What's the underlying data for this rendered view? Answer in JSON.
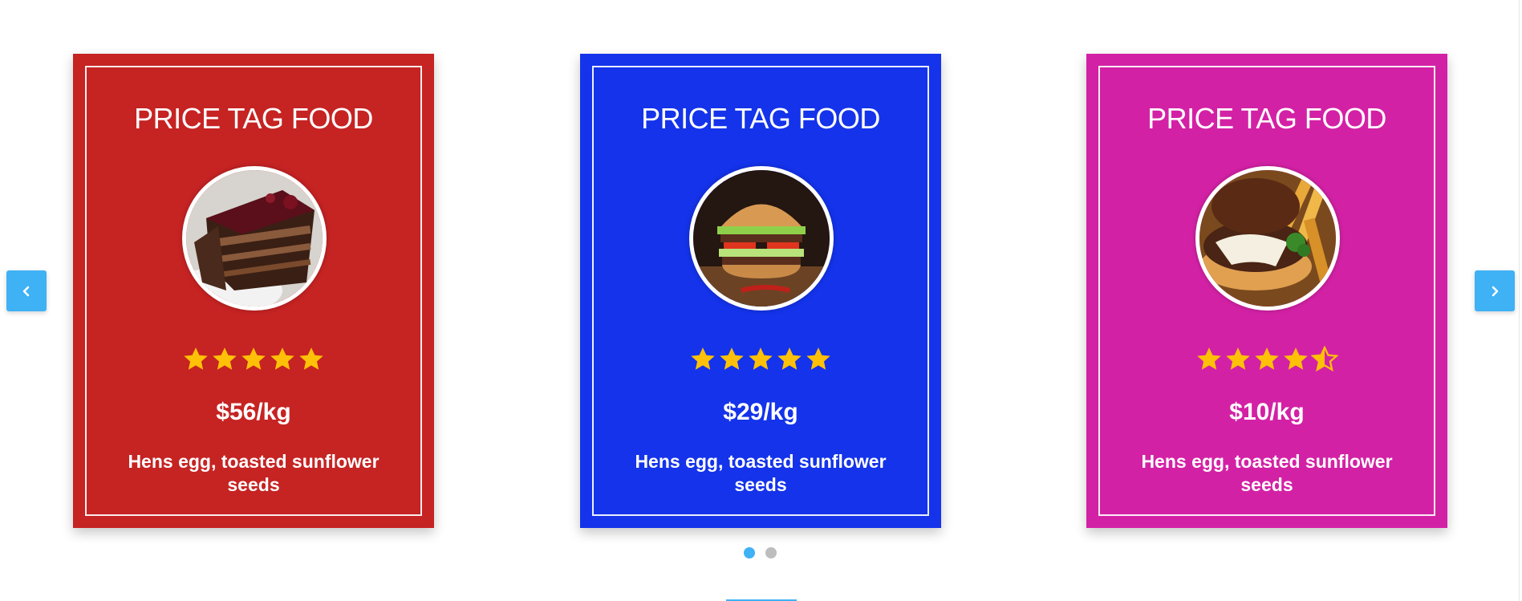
{
  "colors": {
    "card_red": "#c62323",
    "card_blue": "#1433ea",
    "card_magenta": "#d321a5",
    "accent": "#3fb1f5",
    "star": "#ffc107",
    "dot_inactive": "#bdbdbd"
  },
  "cards": [
    {
      "title": "PRICE TAG FOOD",
      "image_icon": "chocolate-cake-image",
      "rating": 5,
      "price": "$56/kg",
      "description": "Hens egg, toasted sunflower seeds"
    },
    {
      "title": "PRICE TAG FOOD",
      "image_icon": "burger-image",
      "rating": 5,
      "price": "$29/kg",
      "description": "Hens egg, toasted sunflower seeds"
    },
    {
      "title": "PRICE TAG FOOD",
      "image_icon": "cheeseburger-fries-image",
      "rating": 4.5,
      "price": "$10/kg",
      "description": "Hens egg, toasted sunflower seeds"
    }
  ],
  "carousel": {
    "prev_icon": "chevron-left-icon",
    "next_icon": "chevron-right-icon",
    "active_page": 1,
    "page_count": 2
  }
}
